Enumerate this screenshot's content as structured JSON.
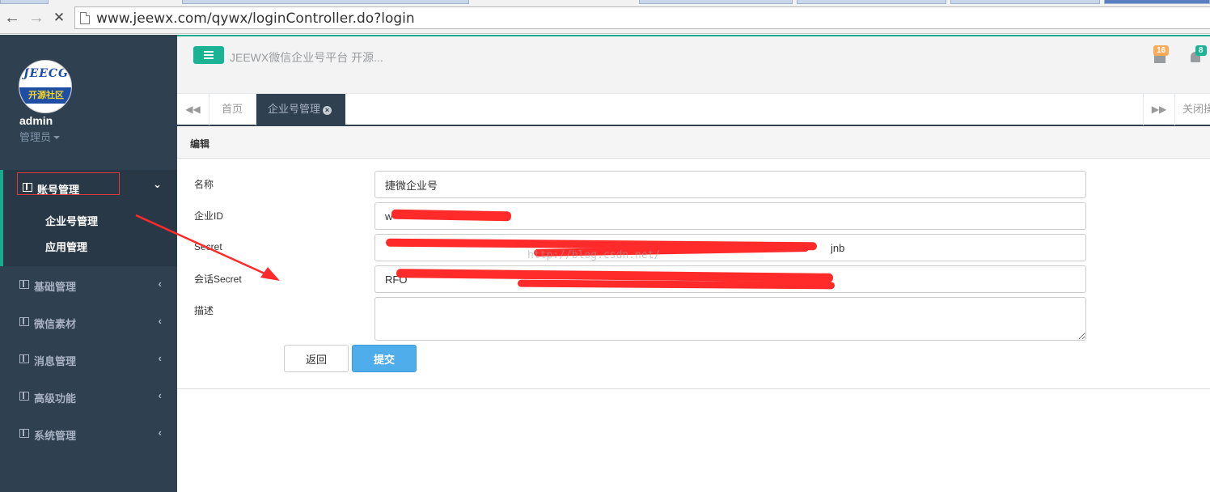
{
  "browser": {
    "url": "www.jeewx.com/qywx/loginController.do?login",
    "back_glyph": "←",
    "forward_glyph": "→",
    "stop_glyph": "✕"
  },
  "sidebar": {
    "logo_top_text": "JEECG",
    "logo_bottom_text": "开源社区",
    "user_name": "admin",
    "user_role": "管理员",
    "menu": [
      {
        "label": "账号管理",
        "arrow": "⌄",
        "open": true
      },
      {
        "label": "基础管理",
        "arrow": "‹"
      },
      {
        "label": "微信素材",
        "arrow": "‹"
      },
      {
        "label": "消息管理",
        "arrow": "‹"
      },
      {
        "label": "高级功能",
        "arrow": "‹"
      },
      {
        "label": "系统管理",
        "arrow": "‹"
      }
    ],
    "submenu": [
      {
        "label": "企业号管理"
      },
      {
        "label": "应用管理"
      }
    ]
  },
  "topbar": {
    "title": "JEEWX微信企业号平台 开源...",
    "mail_count": "16",
    "notify_count": "8"
  },
  "tabs": {
    "back_glyph": "◀◀",
    "forward_glyph": "▶▶",
    "home": "首页",
    "active": "企业号管理",
    "close_glyph": "×",
    "close_all": "关闭操"
  },
  "form": {
    "panel_title": "编辑",
    "fields": [
      {
        "label": "名称",
        "value": "捷微企业号"
      },
      {
        "label": "企业ID",
        "value": "w"
      },
      {
        "label": "Secret",
        "value": "jnb"
      },
      {
        "label": "会话Secret",
        "value": "RFO"
      },
      {
        "label": "描述",
        "value": ""
      }
    ],
    "back_button": "返回",
    "submit_button": "提交"
  },
  "watermark": "http://blog.csdn.net/",
  "colors": {
    "sidebar_bg": "#2f4050",
    "accent_green": "#1ab394",
    "submit_blue": "#4fadec",
    "annotation_red": "#ff2a2a"
  }
}
